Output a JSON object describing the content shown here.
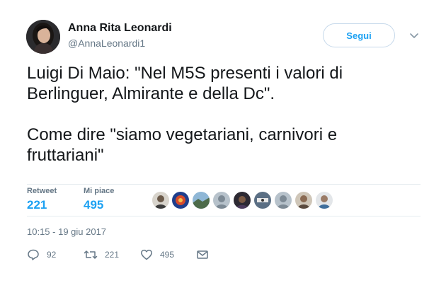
{
  "author": {
    "name": "Anna Rita Leonardi",
    "handle": "@AnnaLeonardi1",
    "avatar_icon": "profile-photo"
  },
  "follow_button": {
    "label": "Segui",
    "color": "#1da1f2"
  },
  "menu_icon": "chevron-down-icon",
  "tweet": {
    "text": "Luigi Di Maio: \"Nel M5S presenti i valori di\nBerlinguer, Almirante e della Dc\".\n\nCome dire \"siamo vegetariani, carnivori e\nfruttariani\""
  },
  "stats": {
    "retweet_label": "Retweet",
    "retweet_count": "221",
    "likes_label": "Mi piace",
    "likes_count": "495"
  },
  "likers_count_shown": 9,
  "timestamp": "10:15 - 19 giu 2017",
  "actions": {
    "reply_icon": "speech-bubble-icon",
    "reply_count": "92",
    "retweet_icon": "retweet-icon",
    "retweet_count": "221",
    "like_icon": "heart-icon",
    "like_count": "495",
    "message_icon": "envelope-icon"
  }
}
